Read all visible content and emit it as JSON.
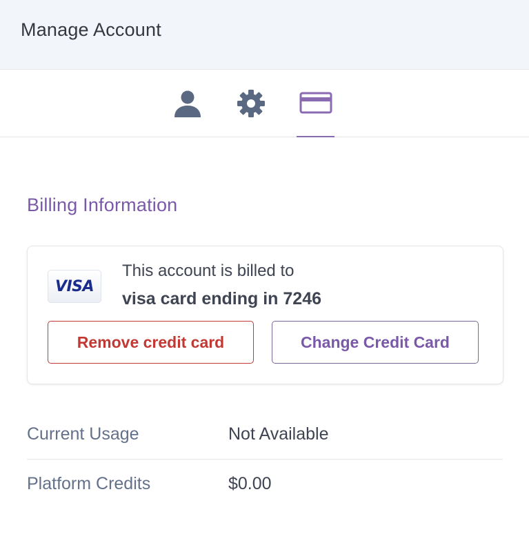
{
  "header": {
    "title": "Manage Account"
  },
  "tabs": [
    {
      "name": "profile",
      "icon": "user-icon",
      "active": false
    },
    {
      "name": "settings",
      "icon": "gear-icon",
      "active": false
    },
    {
      "name": "billing",
      "icon": "credit-card-icon",
      "active": true
    }
  ],
  "colors": {
    "accent": "#7a59a8",
    "danger": "#c23934",
    "icon": "#5a6882"
  },
  "billing": {
    "title": "Billing Information",
    "card_brand": "VISA",
    "billed_to_text": "This account is billed to",
    "card_description": "visa card ending in 7246",
    "remove_button": "Remove credit card",
    "change_button": "Change Credit Card"
  },
  "usage": {
    "current_usage_label": "Current Usage",
    "current_usage_value": "Not Available",
    "platform_credits_label": "Platform Credits",
    "platform_credits_value": "$0.00"
  }
}
